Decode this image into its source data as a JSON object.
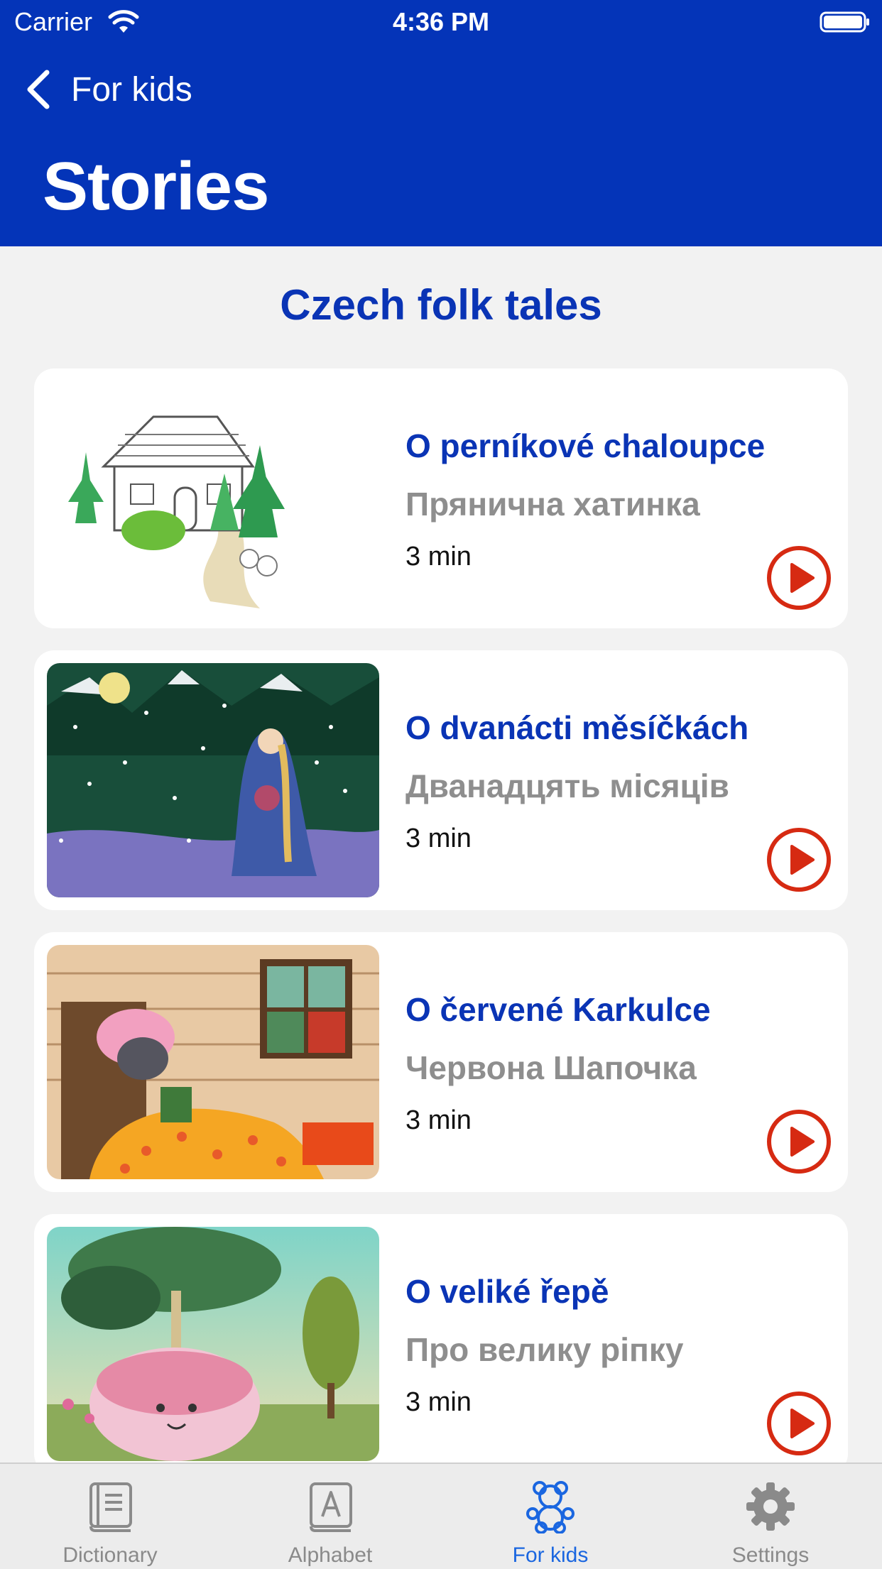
{
  "status_bar": {
    "carrier": "Carrier",
    "time": "4:36 PM"
  },
  "nav": {
    "back_label": "For kids",
    "title": "Stories"
  },
  "section_title": "Czech folk tales",
  "stories": [
    {
      "title": "O perníkové chaloupce",
      "subtitle": "Пряничнa хатинка",
      "duration": "3 min"
    },
    {
      "title": "O dvanácti měsíčkách",
      "subtitle": "Дванадцять місяців",
      "duration": "3 min"
    },
    {
      "title": "O červené Karkulce",
      "subtitle": "Червона Шапочка",
      "duration": "3 min"
    },
    {
      "title": "O veliké řepě",
      "subtitle": "Про велику ріпку",
      "duration": "3 min"
    }
  ],
  "tab_bar": [
    {
      "label": "Dictionary",
      "icon": "book-icon"
    },
    {
      "label": "Alphabet",
      "icon": "alphabet-book-icon"
    },
    {
      "label": "For kids",
      "icon": "teddy-bear-icon",
      "active": true
    },
    {
      "label": "Settings",
      "icon": "gear-icon"
    }
  ],
  "colors": {
    "header": "#0434b8",
    "accent": "#0a34b5",
    "play": "#d62a12",
    "tab_active": "#1a66e0"
  }
}
